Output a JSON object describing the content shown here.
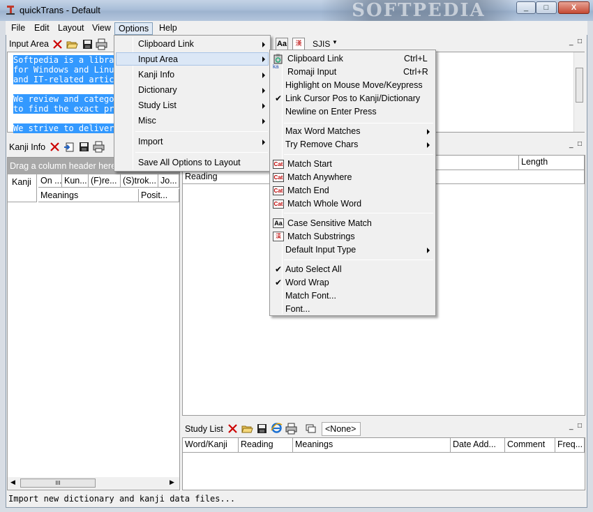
{
  "window": {
    "title": "quickTrans - Default",
    "watermark": "SOFTPEDIA",
    "min": "_",
    "max": "□",
    "close": "X"
  },
  "menubar": [
    "File",
    "Edit",
    "Layout",
    "View",
    "Options",
    "Help"
  ],
  "input_area": {
    "label": "Input Area",
    "encoding": "SJIS",
    "lines": [
      "Softpedia is a librar",
      "for Windows and Linux",
      "and IT-related artic",
      "",
      "We review and categor",
      "to find the exact pro",
      "",
      "We strive to deliver"
    ]
  },
  "kanji_info": {
    "label": "Kanji Info",
    "drag_hint": "Drag a column header here",
    "columns": [
      "Kanji",
      "On ...",
      "Kun...",
      "(F)re...",
      "(S)trok...",
      "Jo..."
    ],
    "sub_columns": [
      "Meanings",
      "Posit..."
    ]
  },
  "results": {
    "columns": [
      "Length"
    ],
    "reading": "Reading"
  },
  "study_list": {
    "label": "Study List",
    "selector": "<None>",
    "columns": [
      "Word/Kanji",
      "Reading",
      "Meanings",
      "Date Add...",
      "Comment",
      "Freq..."
    ]
  },
  "status": "Import new dictionary and kanji data files...",
  "options_menu": {
    "items": [
      "Clipboard Link",
      "Input Area",
      "Kanji Info",
      "Dictionary",
      "Study List",
      "Misc",
      "Import",
      "Save All Options to Layout"
    ]
  },
  "input_area_menu": {
    "items": [
      {
        "label": "Clipboard Link",
        "shortcut": "Ctrl+L"
      },
      {
        "label": "Romaji Input",
        "shortcut": "Ctrl+R"
      },
      {
        "label": "Highlight on Mouse Move/Keypress"
      },
      {
        "label": "Link Cursor Pos to Kanji/Dictionary",
        "checked": true
      },
      {
        "label": "Newline on Enter Press"
      },
      {
        "label": "Max Word Matches"
      },
      {
        "label": "Try Remove Chars"
      },
      {
        "label": "Match Start"
      },
      {
        "label": "Match Anywhere"
      },
      {
        "label": "Match End"
      },
      {
        "label": "Match Whole Word"
      },
      {
        "label": "Case Sensitive Match"
      },
      {
        "label": "Match Substrings"
      },
      {
        "label": "Default Input Type"
      },
      {
        "label": "Auto Select All",
        "checked": true
      },
      {
        "label": "Word Wrap",
        "checked": true
      },
      {
        "label": "Match Font..."
      },
      {
        "label": "Font..."
      }
    ]
  },
  "glyphs": {
    "check": "✔",
    "cat": "Cat",
    "aa": "Aa",
    "romaji": "ka",
    "kanji_sub": "漢",
    "scroll_grip": "III"
  }
}
